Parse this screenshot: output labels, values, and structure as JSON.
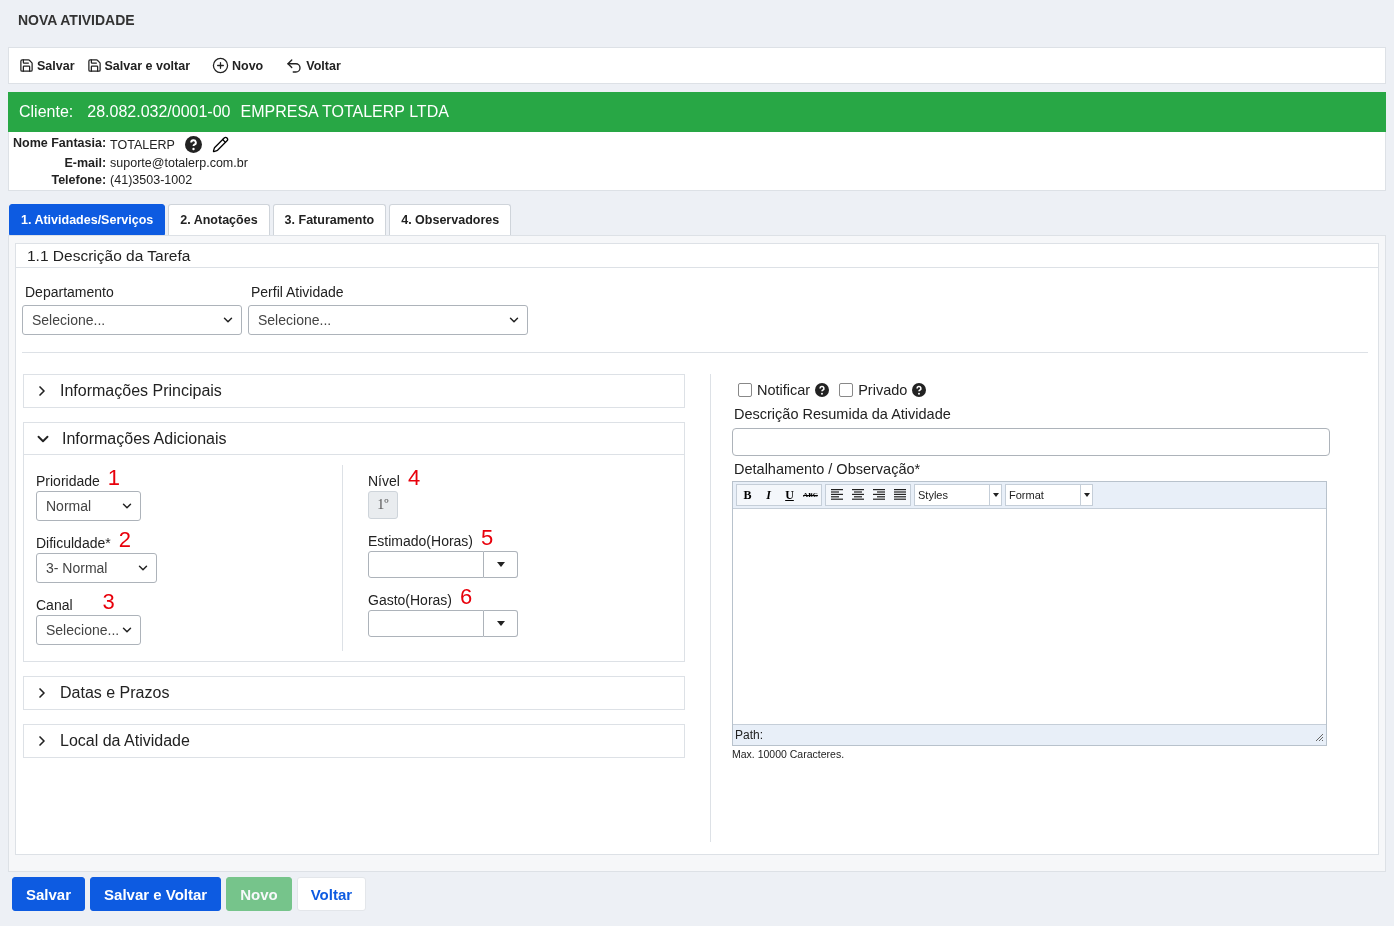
{
  "page_title": "NOVA ATIVIDADE",
  "toolbar": [
    {
      "label": "Salvar",
      "kind": "save"
    },
    {
      "label": "Salvar e voltar",
      "kind": "save"
    },
    {
      "label": "Novo",
      "kind": "new"
    },
    {
      "label": "Voltar",
      "kind": "back"
    }
  ],
  "client": {
    "label": "Cliente:",
    "document": "28.082.032/0001-00",
    "name": "EMPRESA TOTALERP LTDA"
  },
  "client_details": [
    {
      "label": "Nome Fantasia:",
      "value": "TOTALERP",
      "kind": "actions"
    },
    {
      "label": "E-mail:",
      "value": "suporte@totalerp.com.br",
      "kind": "plain"
    },
    {
      "label": "Telefone:",
      "value": "(41)3503-1002",
      "kind": "plain"
    }
  ],
  "tabs": [
    {
      "label": "1. Atividades/Serviços",
      "selected": true
    },
    {
      "label": "2. Anotações",
      "selected": false
    },
    {
      "label": "3. Faturamento",
      "selected": false
    },
    {
      "label": "4. Observadores",
      "selected": false
    }
  ],
  "section_title": "1.1 Descrição da Tarefa",
  "top_fields": [
    {
      "label": "Departamento",
      "value": "Selecione..."
    },
    {
      "label": "Perfil Atividade",
      "value": "Selecione..."
    }
  ],
  "accordions": [
    {
      "title": "Informações Principais",
      "expanded": false
    },
    {
      "title": "Informações Adicionais",
      "expanded": true,
      "left_fields": [
        {
          "label": "Prioridade",
          "marker": "1",
          "kind": "select",
          "value": "Normal"
        },
        {
          "label": "Dificuldade*",
          "marker": "2",
          "kind": "select",
          "value": "3- Normal"
        },
        {
          "label": "Canal",
          "marker": "3",
          "kind": "select",
          "value": "Selecione..."
        }
      ],
      "right_fields": [
        {
          "label": "Nível",
          "marker": "4",
          "kind": "badge",
          "value": "1º"
        },
        {
          "label": "Estimado(Horas)",
          "marker": "5",
          "kind": "combo"
        },
        {
          "label": "Gasto(Horas)",
          "marker": "6",
          "kind": "combo"
        }
      ]
    },
    {
      "title": "Datas e Prazos",
      "expanded": false
    },
    {
      "title": "Local da Atividade",
      "expanded": false
    }
  ],
  "checkboxes": [
    {
      "label": "Notificar",
      "checked": false
    },
    {
      "label": "Privado",
      "checked": false
    }
  ],
  "summary_field": {
    "label": "Descrição Resumida da Atividade"
  },
  "detail_editor": {
    "label": "Detalhamento / Observação*",
    "format_buttons": [
      {
        "label": "B",
        "kind": "bold"
      },
      {
        "label": "I",
        "kind": "italic"
      },
      {
        "label": "U",
        "kind": "underline"
      },
      {
        "label": "ABC",
        "kind": "strike"
      }
    ],
    "selects": [
      "Styles",
      "Format"
    ],
    "path_label": "Path:",
    "hint": "Max. 10000 Caracteres."
  },
  "bottom_buttons": [
    {
      "label": "Salvar",
      "kind": "primary",
      "disabled": false
    },
    {
      "label": "Salvar e Voltar",
      "kind": "primary",
      "disabled": false
    },
    {
      "label": "Novo",
      "kind": "success",
      "disabled": true
    },
    {
      "label": "Voltar",
      "kind": "light",
      "disabled": false
    }
  ]
}
